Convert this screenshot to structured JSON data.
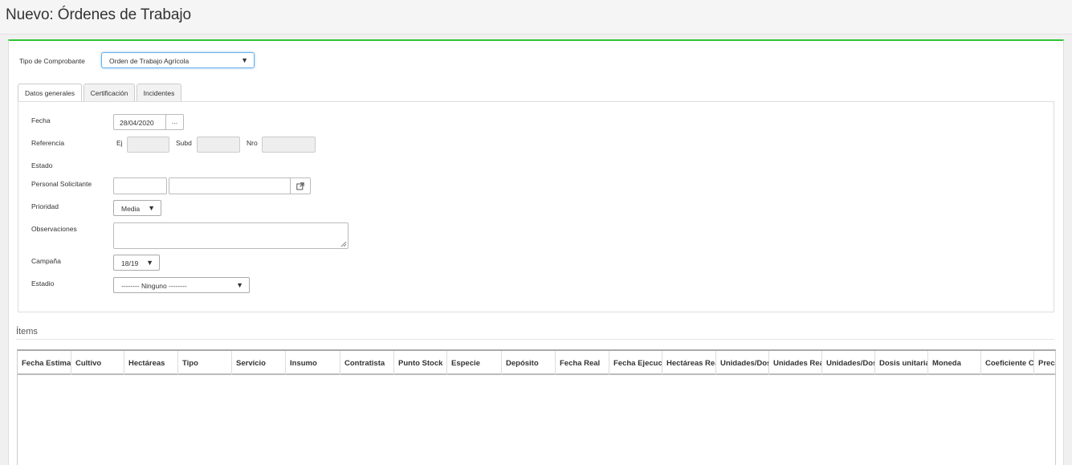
{
  "page": {
    "title": "Nuevo: Órdenes de Trabajo"
  },
  "colors": {
    "accent": "#2ec535",
    "focus": "#66afe9"
  },
  "comprobante": {
    "label": "Tipo de Comprobante",
    "value": "Orden de Trabajo Agrícola"
  },
  "tabs": [
    {
      "label": "Datos generales",
      "active": true
    },
    {
      "label": "Certificación",
      "active": false
    },
    {
      "label": "Incidentes",
      "active": false
    }
  ],
  "form": {
    "fecha": {
      "label": "Fecha",
      "value": "28/04/2020",
      "button": "..."
    },
    "referencia": {
      "label": "Referencia",
      "ej_label": "Ej",
      "subd_label": "Subd",
      "nro_label": "Nro",
      "ej": "",
      "subd": "",
      "nro": ""
    },
    "estado": {
      "label": "Estado"
    },
    "personal": {
      "label": "Personal Solicitante",
      "code": "",
      "name": "",
      "icon": "external-link-icon"
    },
    "prioridad": {
      "label": "Prioridad",
      "value": "Media"
    },
    "observaciones": {
      "label": "Observaciones",
      "value": ""
    },
    "campana": {
      "label": "Campaña",
      "value": "18/19"
    },
    "estadio": {
      "label": "Estadio",
      "value": "-------- Ninguno --------"
    }
  },
  "items": {
    "title": "Ítems",
    "columns": [
      "Fecha Estimada",
      "Cultivo",
      "Hectáreas",
      "Tipo",
      "Servicio",
      "Insumo",
      "Contratista",
      "Punto Stock",
      "Especie",
      "Depósito",
      "Fecha Real",
      "Fecha Ejecución",
      "Hectáreas Reales",
      "Unidades/Dosis",
      "Unidades Reales",
      "Unidades/Dosis",
      "Dosis unitaria",
      "Moneda",
      "Coeficiente Conversión",
      "Precio"
    ],
    "rows": []
  }
}
